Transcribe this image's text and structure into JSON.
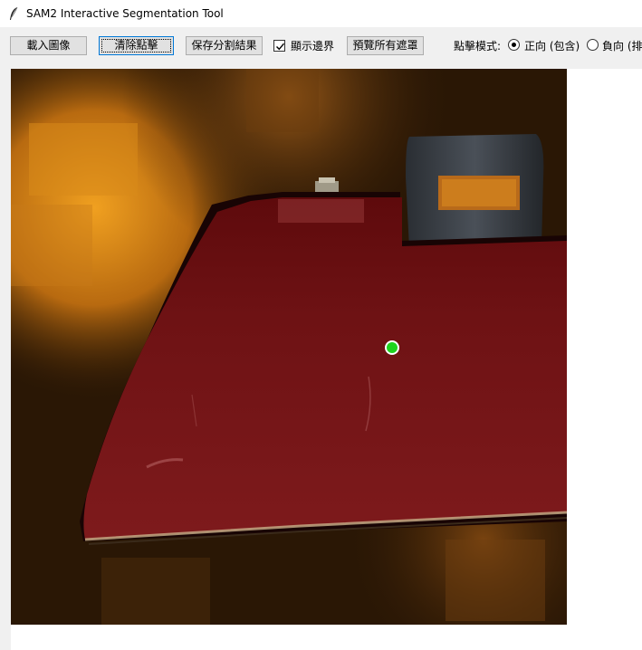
{
  "window": {
    "title": "SAM2 Interactive Segmentation Tool",
    "icon": "feather-icon"
  },
  "toolbar": {
    "load_image": "載入圖像",
    "clear_points": "清除點擊",
    "save_result": "保存分割結果",
    "show_boundary_label": "顯示邊界",
    "show_boundary_checked": true,
    "preview_masks": "預覽所有遮罩",
    "click_mode_label": "點擊模式:",
    "positive_label": "正向 (包含)",
    "negative_label": "負向 (排",
    "selected_mode": "positive"
  },
  "canvas": {
    "point_color": "#1ed31e",
    "mask_color": "#7a1416",
    "point_label": "positive"
  }
}
